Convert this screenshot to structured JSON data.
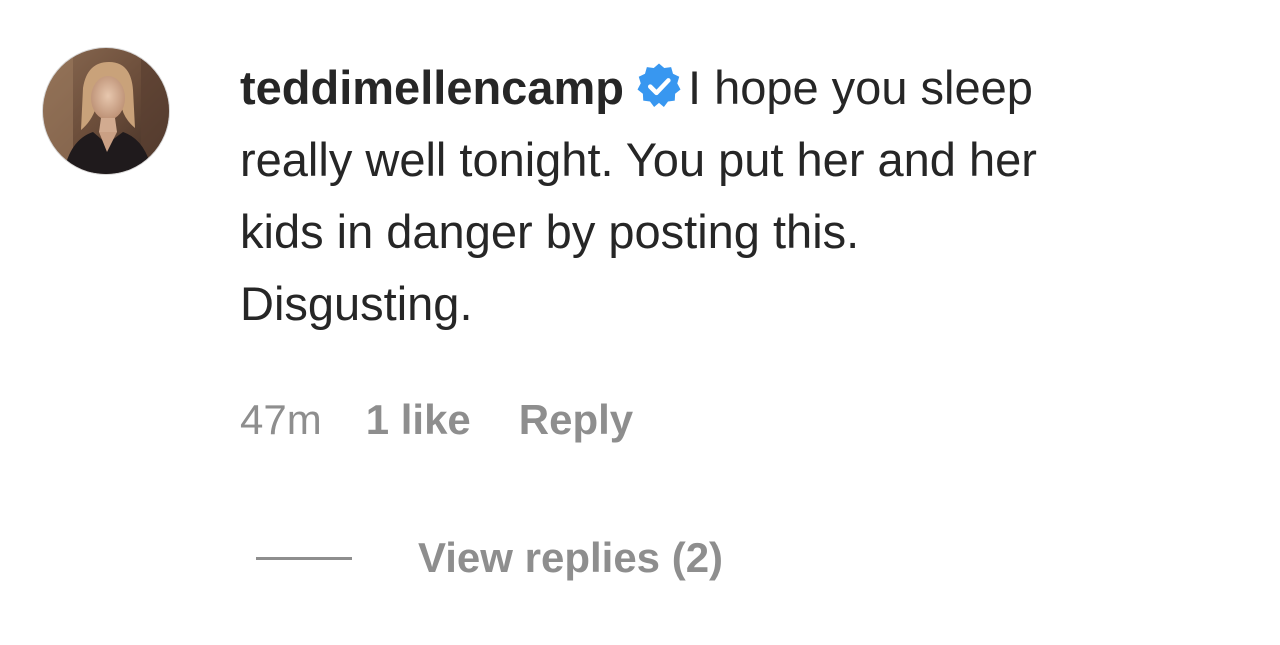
{
  "comment": {
    "avatar_icon": "profile-photo",
    "username": "teddimellencamp",
    "verified_icon": "verified-badge-icon",
    "verified_color": "#3897f0",
    "text": "I hope you sleep\nreally well tonight. You put her and her\nkids in danger by posting this.\nDisgusting.",
    "time": "47m",
    "likes": "1 like",
    "reply_label": "Reply",
    "view_replies_label": "View replies (2)"
  },
  "colors": {
    "text": "#262626",
    "secondary": "#8e8e8e"
  }
}
